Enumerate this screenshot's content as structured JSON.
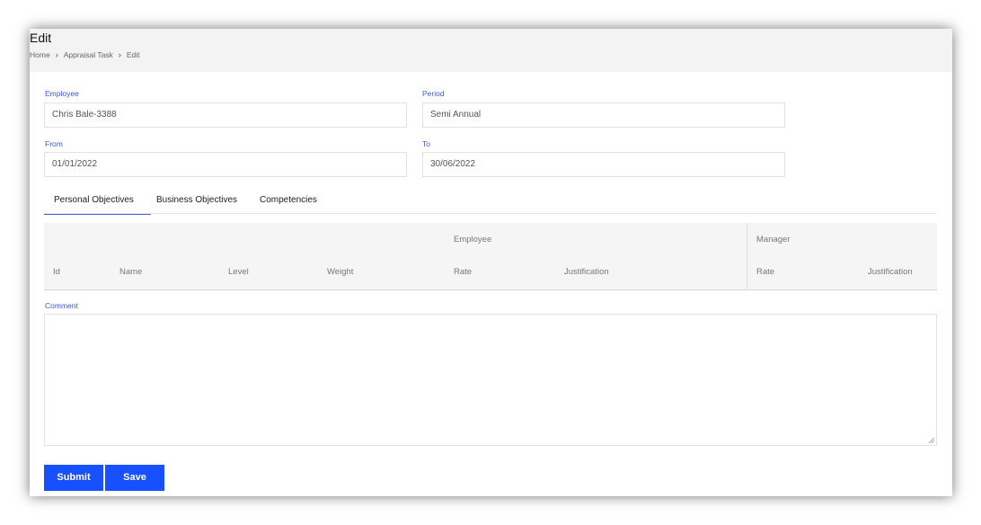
{
  "header": {
    "title": "Edit",
    "breadcrumb": [
      "Home",
      "Appraisal Task",
      "Edit"
    ]
  },
  "form": {
    "employee": {
      "label": "Employee",
      "value": "Chris  Bale-3388"
    },
    "period": {
      "label": "Period",
      "value": "Semi Annual"
    },
    "from": {
      "label": "From",
      "value": "01/01/2022"
    },
    "to": {
      "label": "To",
      "value": "30/06/2022"
    }
  },
  "tabs": [
    {
      "label": "Personal Objectives",
      "active": true
    },
    {
      "label": "Business Objectives",
      "active": false
    },
    {
      "label": "Competencies",
      "active": false
    }
  ],
  "table": {
    "group_headers": [
      "Employee",
      "Manager"
    ],
    "columns": [
      "Id",
      "Name",
      "Level",
      "Weight",
      "Rate",
      "Justification",
      "Rate",
      "Justification"
    ]
  },
  "comment": {
    "label": "Comment",
    "value": ""
  },
  "actions": {
    "submit": "Submit",
    "save": "Save"
  },
  "colors": {
    "accent": "#1750ff",
    "label": "#3d5ad9",
    "header_bg": "#f3f3f3"
  }
}
